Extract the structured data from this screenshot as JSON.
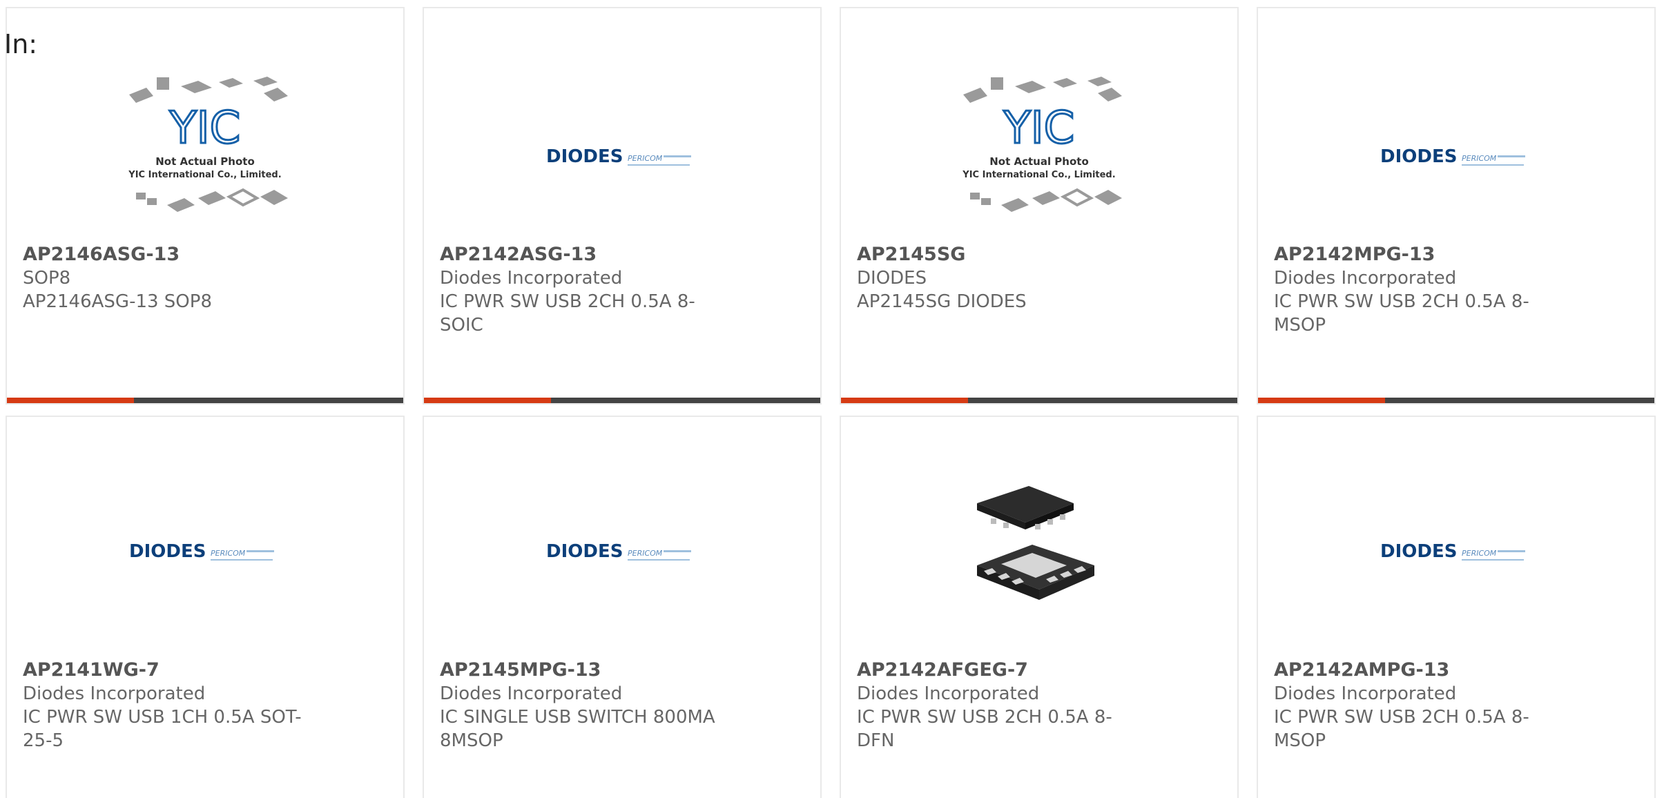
{
  "in_label": "In:",
  "colors": {
    "accent": "#d63b14",
    "bar": "#444444",
    "text": "#666666"
  },
  "products": [
    {
      "part": "AP2146ASG-13",
      "mfr": "SOP8",
      "desc": "AP2146ASG-13 SOP8",
      "image": "yic-not-actual-photo",
      "yic": {
        "brand": "YIC",
        "line1": "Not Actual Photo",
        "line2": "YIC International Co., Limited."
      }
    },
    {
      "part": "AP2142ASG-13",
      "mfr": "Diodes Incorporated",
      "desc": "IC PWR SW USB 2CH 0.5A 8-SOIC",
      "image": "diodes-logo",
      "logo": {
        "brand": "DIODES",
        "sub": "PERICOM"
      }
    },
    {
      "part": "AP2145SG",
      "mfr": "DIODES",
      "desc": "AP2145SG DIODES",
      "image": "yic-not-actual-photo",
      "yic": {
        "brand": "YIC",
        "line1": "Not Actual Photo",
        "line2": "YIC International Co., Limited."
      }
    },
    {
      "part": "AP2142MPG-13",
      "mfr": "Diodes Incorporated",
      "desc": "IC PWR SW USB 2CH 0.5A 8-MSOP",
      "image": "diodes-logo",
      "logo": {
        "brand": "DIODES",
        "sub": "PERICOM"
      }
    },
    {
      "part": "AP2141WG-7",
      "mfr": "Diodes Incorporated",
      "desc": "IC PWR SW USB 1CH 0.5A SOT-25-5",
      "image": "diodes-logo",
      "logo": {
        "brand": "DIODES",
        "sub": "PERICOM"
      }
    },
    {
      "part": "AP2145MPG-13",
      "mfr": "Diodes Incorporated",
      "desc": "IC SINGLE USB SWITCH 800MA 8MSOP",
      "image": "diodes-logo",
      "logo": {
        "brand": "DIODES",
        "sub": "PERICOM"
      }
    },
    {
      "part": "AP2142AFGEG-7",
      "mfr": "Diodes Incorporated",
      "desc": "IC PWR SW USB 2CH 0.5A 8-DFN",
      "image": "dfn-chip-photo"
    },
    {
      "part": "AP2142AMPG-13",
      "mfr": "Diodes Incorporated",
      "desc": "IC PWR SW USB 2CH 0.5A 8-MSOP",
      "image": "diodes-logo",
      "logo": {
        "brand": "DIODES",
        "sub": "PERICOM"
      }
    }
  ]
}
